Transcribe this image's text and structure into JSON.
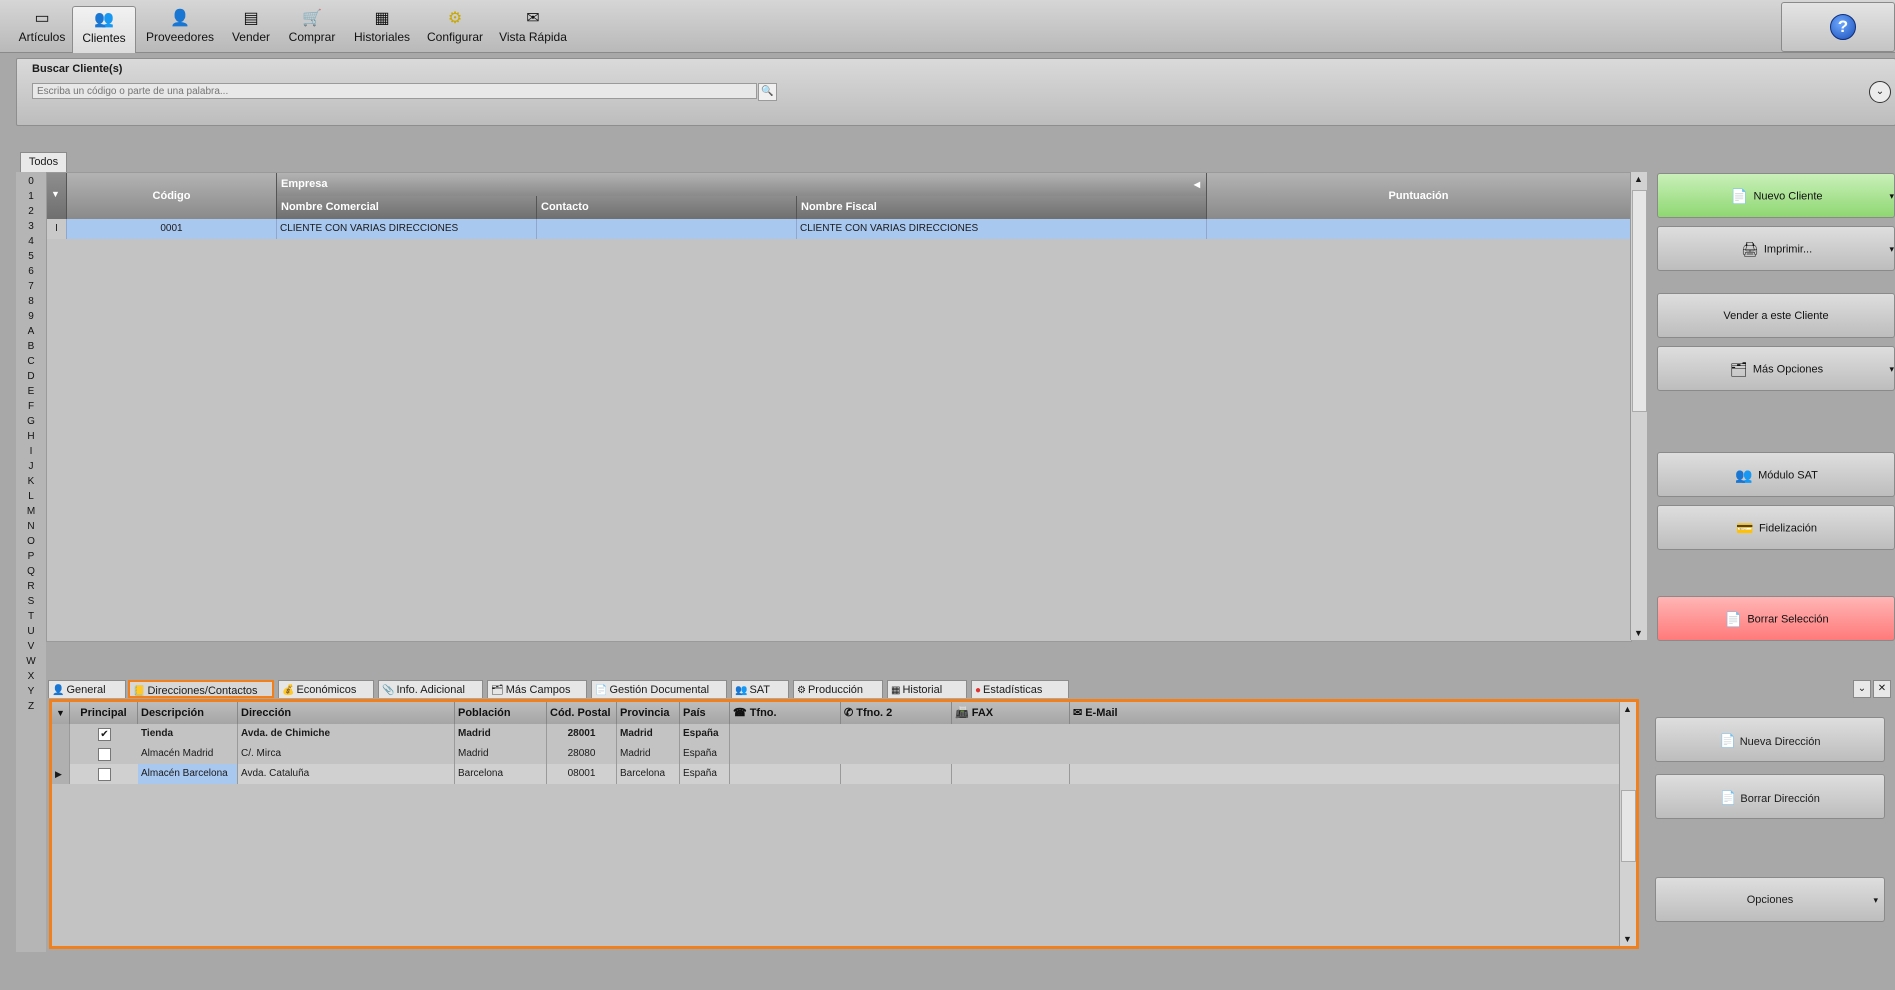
{
  "toolbar": {
    "items": [
      {
        "label": "Artículos",
        "icon": "folder-icon"
      },
      {
        "label": "Clientes",
        "icon": "clients-icon"
      },
      {
        "label": "Proveedores",
        "icon": "supplier-icon"
      },
      {
        "label": "Vender",
        "icon": "cash-register-icon"
      },
      {
        "label": "Comprar",
        "icon": "cart-icon"
      },
      {
        "label": "Historiales",
        "icon": "history-icon"
      },
      {
        "label": "Configurar",
        "icon": "gear-icon"
      },
      {
        "label": "Vista Rápida",
        "icon": "quickview-icon"
      }
    ],
    "active": "Clientes",
    "help_icon": "?"
  },
  "search": {
    "title": "Buscar Cliente(s)",
    "placeholder": "Escriba un código o parte de una palabra..."
  },
  "tabs": {
    "todos": "Todos"
  },
  "alphabet": [
    "0",
    "1",
    "2",
    "3",
    "4",
    "5",
    "6",
    "7",
    "8",
    "9",
    "A",
    "B",
    "C",
    "D",
    "E",
    "F",
    "G",
    "H",
    "I",
    "J",
    "K",
    "L",
    "M",
    "N",
    "O",
    "P",
    "Q",
    "R",
    "S",
    "T",
    "U",
    "V",
    "W",
    "X",
    "Y",
    "Z"
  ],
  "clients_grid": {
    "headers": {
      "codigo": "Código",
      "empresa": "Empresa",
      "nombre_comercial": "Nombre Comercial",
      "contacto": "Contacto",
      "nombre_fiscal": "Nombre Fiscal",
      "puntuacion": "Puntuación"
    },
    "rows": [
      {
        "codigo": "0001",
        "nombre_comercial": "CLIENTE CON VARIAS DIRECCIONES",
        "contacto": "",
        "nombre_fiscal": "CLIENTE CON VARIAS DIRECCIONES",
        "puntuacion": ""
      }
    ],
    "row_marker": "I"
  },
  "right_buttons": {
    "nuevo_cliente": "Nuevo Cliente",
    "imprimir": "Imprimir...",
    "vender_cliente": "Vender a este Cliente",
    "mas_opciones": "Más Opciones",
    "modulo_sat": "Módulo SAT",
    "fidelizacion": "Fidelización",
    "borrar_seleccion": "Borrar Selección"
  },
  "bottom_tabs": [
    {
      "label": "General",
      "icon": "person-icon"
    },
    {
      "label": "Direcciones/Contactos",
      "icon": "book-icon"
    },
    {
      "label": "Económicos",
      "icon": "money-icon"
    },
    {
      "label": "Info. Adicional",
      "icon": "info-icon"
    },
    {
      "label": "Más Campos",
      "icon": "fields-icon"
    },
    {
      "label": "Gestión Documental",
      "icon": "document-icon"
    },
    {
      "label": "SAT",
      "icon": "sat-icon"
    },
    {
      "label": "Producción",
      "icon": "production-icon"
    },
    {
      "label": "Historial",
      "icon": "history-icon"
    },
    {
      "label": "Estadísticas",
      "icon": "chart-icon"
    }
  ],
  "addresses": {
    "headers": {
      "principal": "Principal",
      "descripcion": "Descripción",
      "direccion": "Dirección",
      "poblacion": "Población",
      "cod_postal": "Cód. Postal",
      "provincia": "Provincia",
      "pais": "País",
      "tfno": "Tfno.",
      "tfno2": "Tfno. 2",
      "fax": "FAX",
      "email": "E-Mail"
    },
    "rows": [
      {
        "principal": true,
        "descripcion": "Tienda",
        "direccion": "Avda. de Chimiche",
        "poblacion": "Madrid",
        "cod_postal": "28001",
        "provincia": "Madrid",
        "pais": "España"
      },
      {
        "principal": false,
        "descripcion": "Almacén Madrid",
        "direccion": "C/. Mirca",
        "poblacion": "Madrid",
        "cod_postal": "28080",
        "provincia": "Madrid",
        "pais": "España"
      },
      {
        "principal": false,
        "descripcion": "Almacén Barcelona",
        "direccion": "Avda. Cataluña",
        "poblacion": "Barcelona",
        "cod_postal": "08001",
        "provincia": "Barcelona",
        "pais": "España"
      }
    ]
  },
  "address_buttons": {
    "nueva_direccion": "Nueva Dirección",
    "borrar_direccion": "Borrar Dirección",
    "opciones": "Opciones"
  },
  "colors": {
    "highlight": "#f07f1c",
    "selected_row": "#a9c8f0",
    "nuevo_cliente_bg": "#a7e38f",
    "borrar_bg": "#ff8c8c"
  }
}
